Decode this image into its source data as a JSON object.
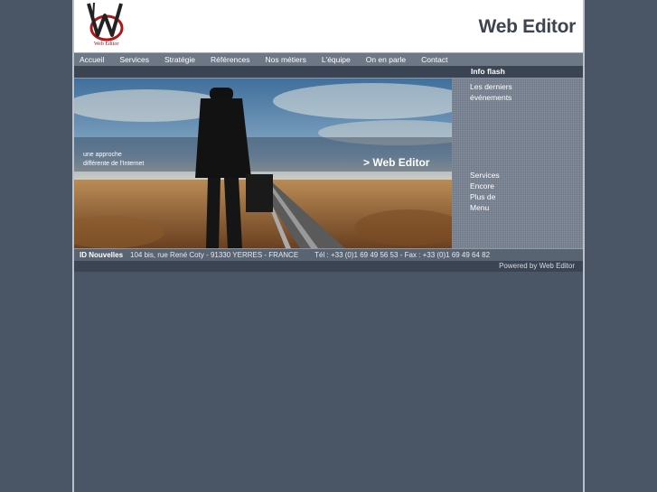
{
  "header": {
    "logo_text": "Web Editor",
    "brand_title": "Web Editor"
  },
  "nav": {
    "items": [
      "Accueil",
      "Services",
      "Stratégie",
      "Références",
      "Nos métiers",
      "L'équipe",
      "On en parle",
      "Contact"
    ]
  },
  "info_flash": {
    "label": "Info flash",
    "events_line1": "Les derniers",
    "events_line2": "événements"
  },
  "hero": {
    "tagline_line1": "une approche",
    "tagline_line2": "différente de l'Internet",
    "banner": ">  Web Editor"
  },
  "side_menu": {
    "items": [
      "Services",
      "Encore",
      "Plus de",
      "Menu"
    ]
  },
  "footer": {
    "company": "ID Nouvelles",
    "address": "104 bis, rue René Coty - 91330 YERRES - FRANCE",
    "phone": "Tél : +33 (0)1 69 49 56 53 - Fax : +33 (0)1 69 49 64 82",
    "powered": "Powered by  Web Editor"
  },
  "colors": {
    "background": "#4a5566",
    "nav": "#6d7886",
    "dark_bar": "#3b4452"
  }
}
